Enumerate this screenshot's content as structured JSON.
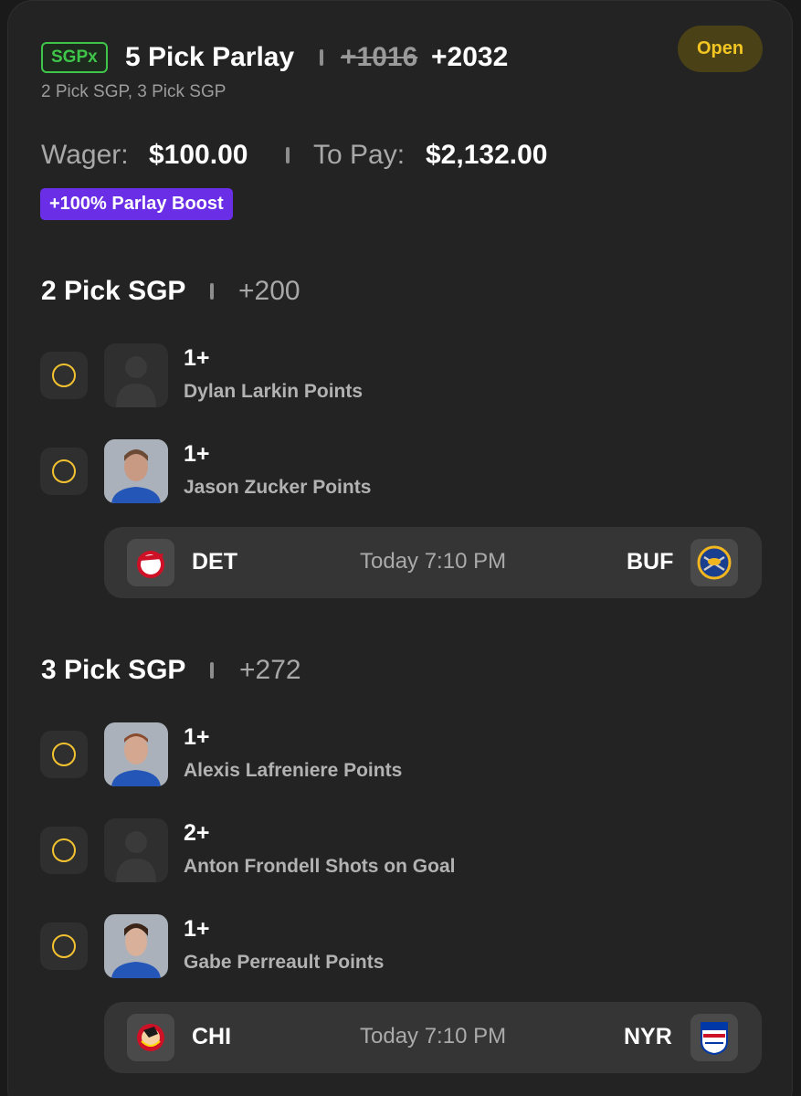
{
  "bet": {
    "badge": "SGPx",
    "title": "5 Pick Parlay",
    "odds_original": "+1016",
    "odds_boosted": "+2032",
    "subtitle": "2 Pick SGP, 3 Pick SGP",
    "status": "Open",
    "wager_label": "Wager:",
    "wager_value": "$100.00",
    "pay_label": "To Pay:",
    "pay_value": "$2,132.00",
    "boost_label": "+100% Parlay Boost"
  },
  "sections": [
    {
      "title": "2 Pick SGP",
      "odds": "+200",
      "picks": [
        {
          "line": "1+",
          "desc": "Dylan Larkin Points",
          "avatar": "placeholder"
        },
        {
          "line": "1+",
          "desc": "Jason Zucker Points",
          "avatar": "player"
        }
      ],
      "game": {
        "away": "DET",
        "time": "Today 7:10 PM",
        "home": "BUF"
      }
    },
    {
      "title": "3 Pick SGP",
      "odds": "+272",
      "picks": [
        {
          "line": "1+",
          "desc": "Alexis Lafreniere Points",
          "avatar": "player"
        },
        {
          "line": "2+",
          "desc": "Anton Frondell Shots on Goal",
          "avatar": "placeholder"
        },
        {
          "line": "1+",
          "desc": "Gabe Perreault Points",
          "avatar": "player"
        }
      ],
      "game": {
        "away": "CHI",
        "time": "Today 7:10 PM",
        "home": "NYR"
      }
    }
  ],
  "colors": {
    "accent_green": "#3fc64a",
    "status_yellow": "#f3c623",
    "boost_purple": "#6a2ee6",
    "pick_ring": "#f2c230"
  },
  "icons": {
    "det": "red-wings-logo-icon",
    "buf": "sabres-logo-icon",
    "chi": "blackhawks-logo-icon",
    "nyr": "rangers-logo-icon"
  }
}
